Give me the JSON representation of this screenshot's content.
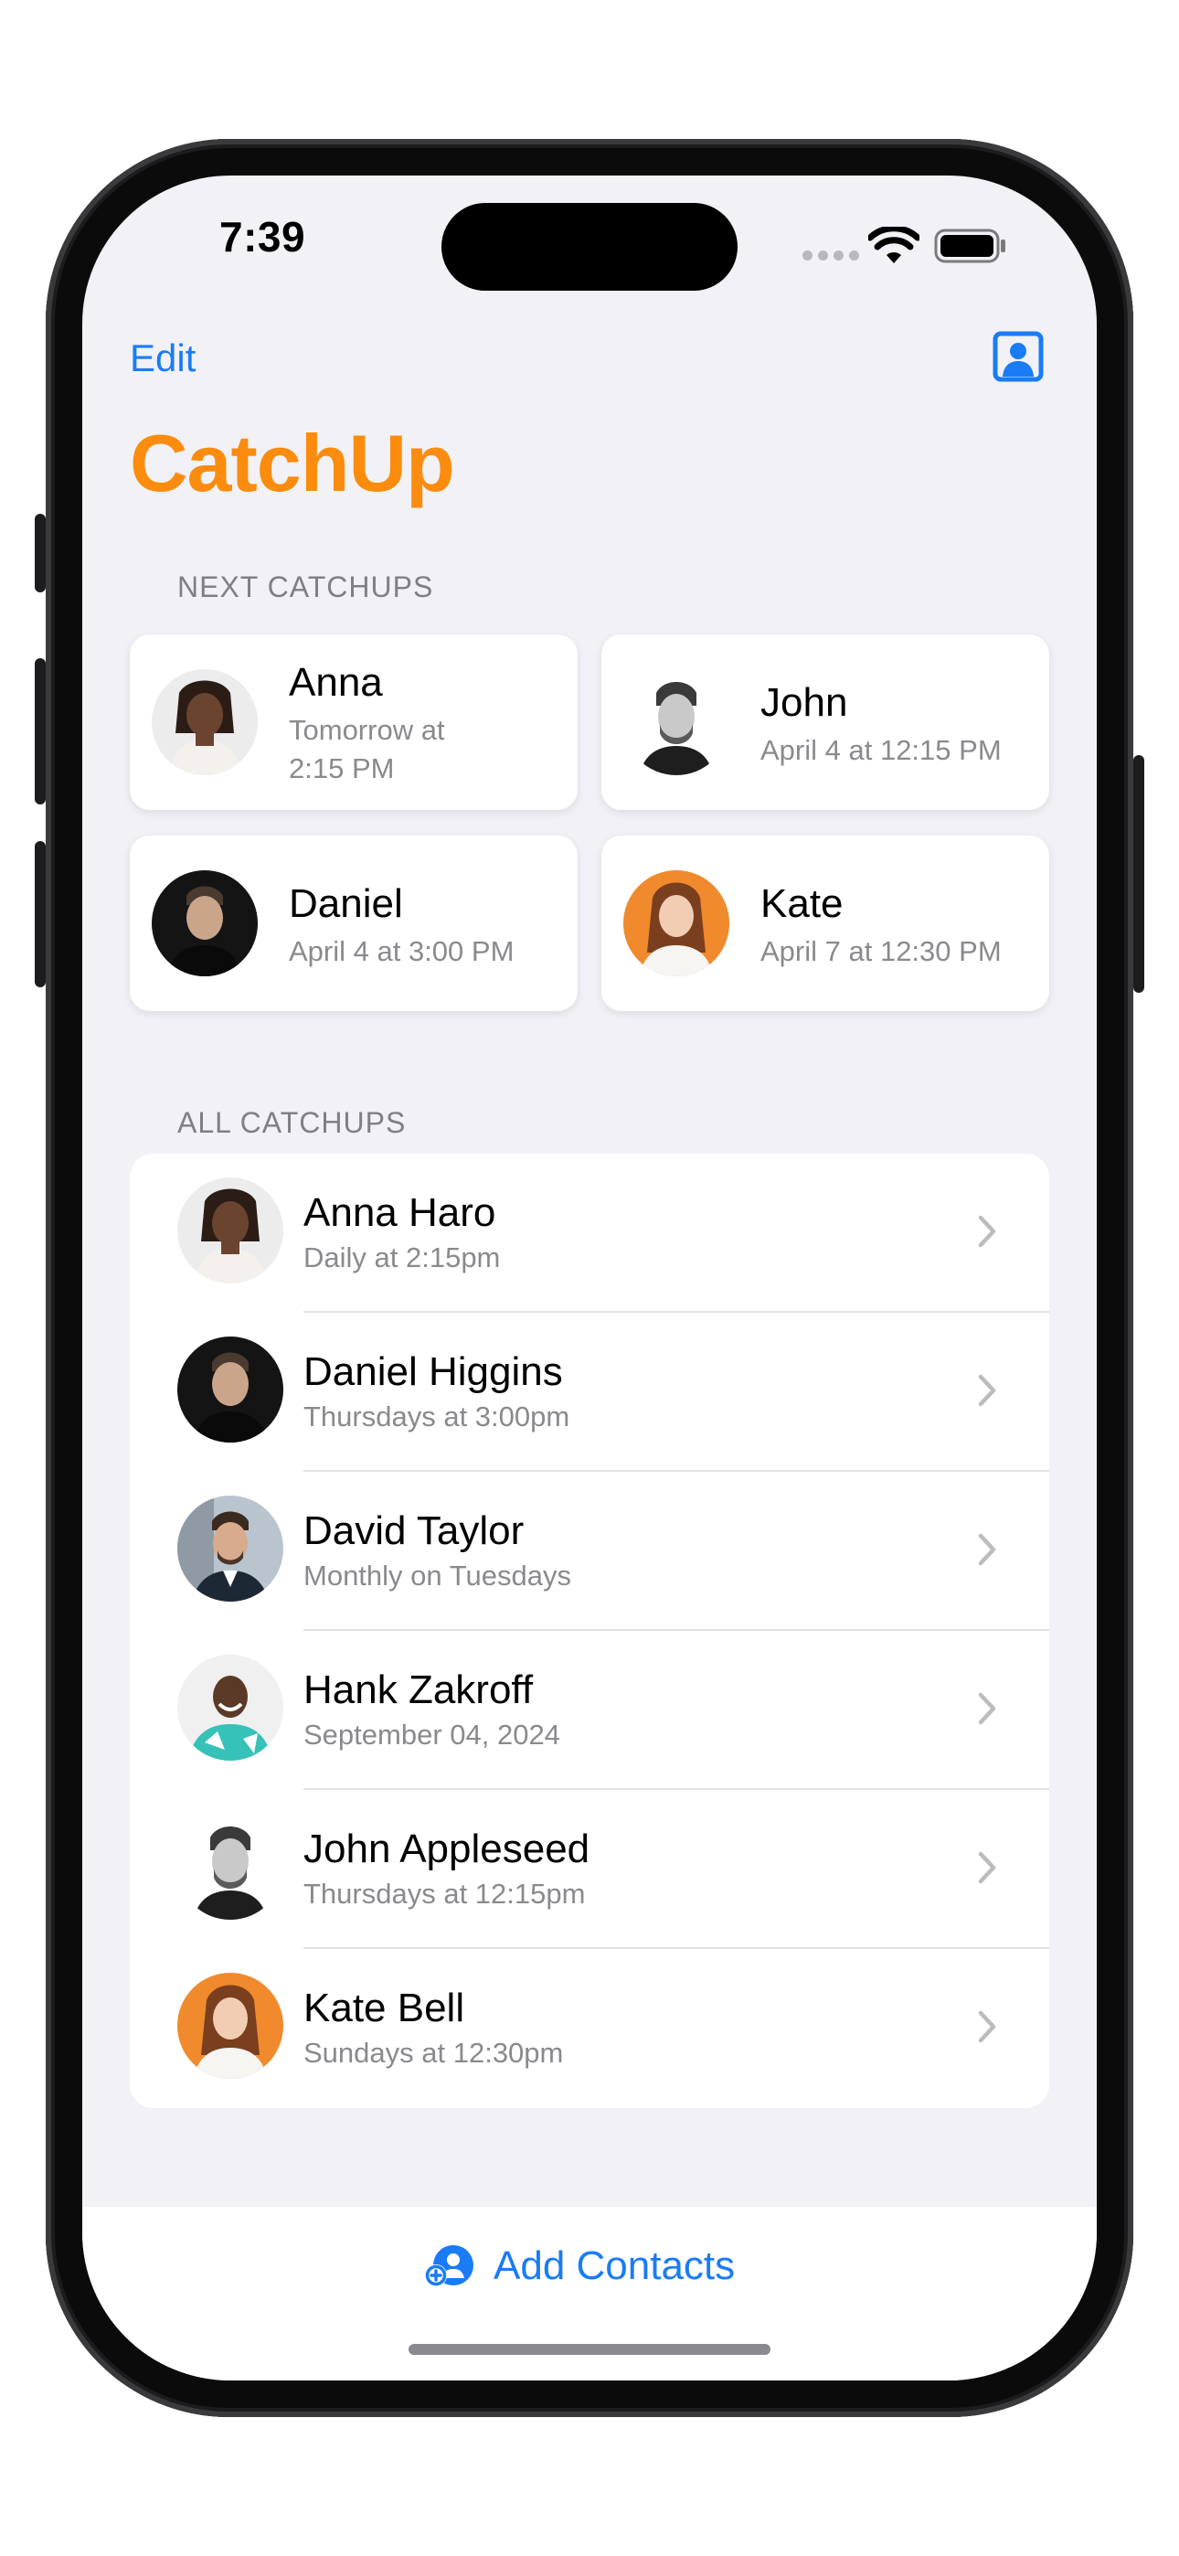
{
  "status_bar": {
    "time": "7:39"
  },
  "nav": {
    "edit_label": "Edit",
    "profile_icon": "person-square-icon"
  },
  "app_title": "CatchUp",
  "colors": {
    "accent_orange": "#fb8c0e",
    "link_blue": "#1a7cf5",
    "background": "#f2f1f6"
  },
  "next_catchups": {
    "header": "NEXT CATCHUPS",
    "cards": [
      {
        "name": "Anna",
        "time_line1": "Tomorrow at",
        "time_line2": "2:15 PM"
      },
      {
        "name": "John",
        "time_line1": "April 4 at 12:15 PM"
      },
      {
        "name": "Daniel",
        "time_line1": "April 4 at 3:00 PM"
      },
      {
        "name": "Kate",
        "time_line1": "April 7 at 12:30 PM"
      }
    ]
  },
  "all_catchups": {
    "header": "ALL CATCHUPS",
    "rows": [
      {
        "name": "Anna Haro",
        "schedule": "Daily at 2:15pm"
      },
      {
        "name": "Daniel Higgins",
        "schedule": "Thursdays at 3:00pm"
      },
      {
        "name": "David Taylor",
        "schedule": "Monthly on Tuesdays"
      },
      {
        "name": "Hank Zakroff",
        "schedule": "September 04, 2024"
      },
      {
        "name": "John Appleseed",
        "schedule": "Thursdays at 12:15pm"
      },
      {
        "name": "Kate Bell",
        "schedule": "Sundays at 12:30pm"
      }
    ]
  },
  "bottom_bar": {
    "add_contacts_label": "Add Contacts",
    "add_contacts_icon": "person-add-icon"
  }
}
